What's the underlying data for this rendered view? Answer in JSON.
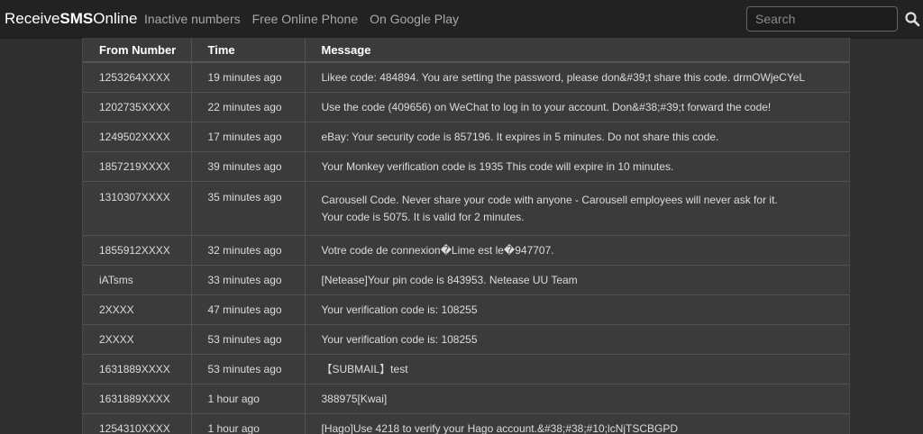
{
  "navbar": {
    "brand_pre": "Receive",
    "brand_bold": "SMS",
    "brand_post": "Online",
    "links": [
      "Inactive numbers",
      "Free Online Phone",
      "On Google Play"
    ],
    "search_placeholder": "Search",
    "search_icon": "search-icon"
  },
  "table": {
    "headers": [
      "From Number",
      "Time",
      "Message"
    ],
    "rows": [
      {
        "from": "1253264XXXX",
        "time": "19 minutes ago",
        "message": "Likee code: 484894. You are setting the password, please don&#39;t share this code. drmOWjeCYeL"
      },
      {
        "from": "1202735XXXX",
        "time": "22 minutes ago",
        "message": "Use the code (409656) on WeChat to log in to your account. Don&#38;#39;t forward the code!"
      },
      {
        "from": "1249502XXXX",
        "time": "17 minutes ago",
        "message": "eBay: Your security code is 857196. It expires in 5 minutes. Do not share this code."
      },
      {
        "from": "1857219XXXX",
        "time": "39 minutes ago",
        "message": "Your Monkey verification code is 1935 This code will expire in 10 minutes."
      },
      {
        "from": "1310307XXXX",
        "time": "35 minutes ago",
        "message": "Carousell Code. Never share your code with anyone - Carousell employees will never ask for it. Your code is 5075. It is valid for 2 minutes."
      },
      {
        "from": "1855912XXXX",
        "time": "32 minutes ago",
        "message": "Votre code de connexion�Lime est le�947707."
      },
      {
        "from": "iATsms",
        "time": "33 minutes ago",
        "message": "[Netease]Your pin code is 843953. Netease UU Team"
      },
      {
        "from": "2XXXX",
        "time": "47 minutes ago",
        "message": "Your verification code is: 108255"
      },
      {
        "from": "2XXXX",
        "time": "53 minutes ago",
        "message": "Your verification code is: 108255"
      },
      {
        "from": "1631889XXXX",
        "time": "53 minutes ago",
        "message": "【SUBMAIL】test"
      },
      {
        "from": "1631889XXXX",
        "time": "1 hour ago",
        "message": "388975[Kwai]"
      },
      {
        "from": "1254310XXXX",
        "time": "1 hour ago",
        "message": "[Hago]Use 4218 to verify your Hago account.&#38;#38;#10;lcNjTSCBGPD"
      }
    ]
  }
}
